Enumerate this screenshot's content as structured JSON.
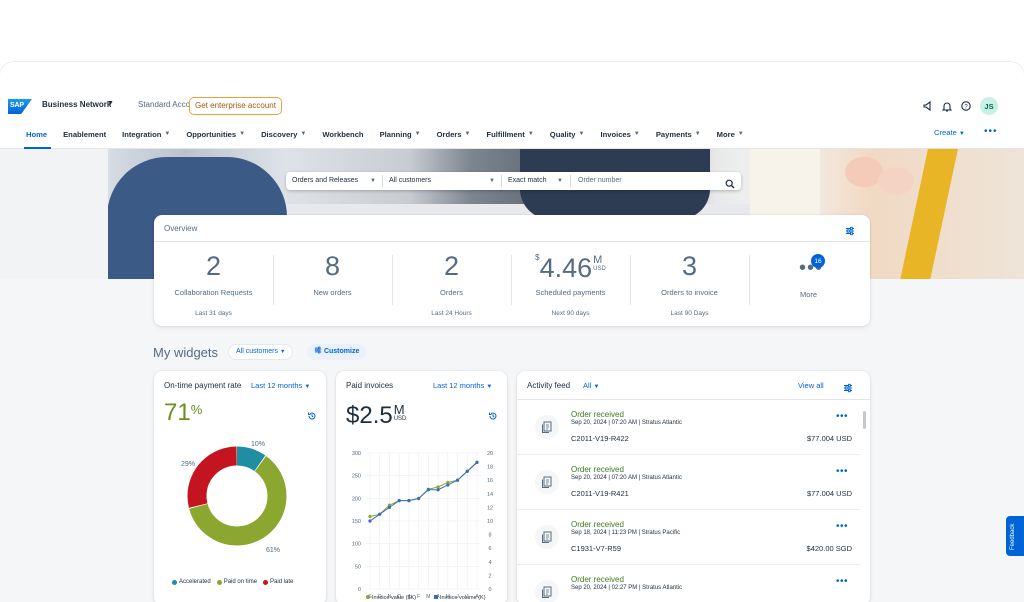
{
  "shell": {
    "logo": "SAP",
    "product": "Business Network",
    "account": "Standard Account",
    "enterprise_button": "Get enterprise account",
    "avatar_initials": "JS"
  },
  "nav": {
    "items": [
      {
        "label": "Home",
        "active": true,
        "dropdown": false
      },
      {
        "label": "Enablement",
        "dropdown": false
      },
      {
        "label": "Integration",
        "dropdown": true
      },
      {
        "label": "Opportunities",
        "dropdown": true
      },
      {
        "label": "Discovery",
        "dropdown": true
      },
      {
        "label": "Workbench",
        "dropdown": false
      },
      {
        "label": "Planning",
        "dropdown": true
      },
      {
        "label": "Orders",
        "dropdown": true
      },
      {
        "label": "Fulfillment",
        "dropdown": true
      },
      {
        "label": "Quality",
        "dropdown": true
      },
      {
        "label": "Invoices",
        "dropdown": true
      },
      {
        "label": "Payments",
        "dropdown": true
      },
      {
        "label": "More",
        "dropdown": true
      }
    ],
    "create": "Create"
  },
  "search": {
    "type": "Orders and Releases",
    "customers": "All customers",
    "match": "Exact match",
    "placeholder": "Order number"
  },
  "overview": {
    "title": "Overview",
    "kpis": [
      {
        "value": "2",
        "label": "Collaboration Requests",
        "sub": "Last 31 days"
      },
      {
        "value": "8",
        "label": "New orders",
        "sub": ""
      },
      {
        "value": "2",
        "label": "Orders",
        "sub": "Last 24 Hours"
      },
      {
        "currency": "$",
        "value": "4.46",
        "unit": "M",
        "unit_sub": "USD",
        "label": "Scheduled payments",
        "sub": "Next 90 days"
      },
      {
        "value": "3",
        "label": "Orders to invoice",
        "sub": "Last 90 Days"
      },
      {
        "label": "More",
        "badge": "16"
      }
    ]
  },
  "widgets": {
    "title": "My widgets",
    "customers": "All customers",
    "customize": "Customize"
  },
  "ontime": {
    "title": "On-time payment rate",
    "filter": "Last 12 months",
    "value": "71",
    "pct": "%",
    "slices": [
      {
        "name": "Accelerated",
        "pct": 10,
        "label": "10%",
        "color": "#1f8ea3"
      },
      {
        "name": "Paid on time",
        "pct": 61,
        "label": "61%",
        "color": "#8ba72f"
      },
      {
        "name": "Paid late",
        "pct": 29,
        "label": "29%",
        "color": "#c4141f"
      }
    ]
  },
  "paid": {
    "title": "Paid invoices",
    "filter": "Last 12 months",
    "value": "$2.5",
    "unit": "M",
    "unit_sub": "USD",
    "legend_value": "Invoice value ($K)",
    "legend_volume": "Invoice volume (K)"
  },
  "chart_data": {
    "type": "line",
    "categories": [
      "S",
      "O",
      "N",
      "D",
      "J",
      "F",
      "M",
      "A",
      "M",
      "J",
      "J",
      "A"
    ],
    "year_labels": [
      "2023",
      "2024"
    ],
    "ylim_left": [
      0,
      300
    ],
    "yticks_left": [
      0,
      50,
      100,
      150,
      200,
      250,
      300
    ],
    "ylim_right": [
      0,
      20
    ],
    "yticks_right": [
      0,
      2,
      4,
      6,
      8,
      10,
      12,
      14,
      16,
      18,
      20
    ],
    "grid": true,
    "legend_position": "bottom",
    "series": [
      {
        "name": "Invoice value ($K)",
        "axis": "left",
        "color": "#8ba72f",
        "values": [
          160,
          165,
          185,
          195,
          195,
          200,
          220,
          225,
          235,
          240,
          260,
          280
        ]
      },
      {
        "name": "Invoice volume (K)",
        "axis": "right",
        "color": "#3b6bbf",
        "values": [
          10,
          11,
          12,
          13,
          13,
          13.3,
          14.6,
          14.6,
          15.3,
          16,
          17.3,
          18.6
        ]
      }
    ]
  },
  "activity": {
    "title": "Activity feed",
    "filter": "All",
    "view_all": "View all",
    "items": [
      {
        "title": "Order received",
        "meta": "Sep 20, 2024  |  07:20 AM  |  Stratus Atlantic",
        "id": "C2011-V19-R422",
        "amount": "$77.004 USD"
      },
      {
        "title": "Order received",
        "meta": "Sep 20, 2024  |  07:20 AM  |  Stratus Atlantic",
        "id": "C2011-V19-R421",
        "amount": "$77.004 USD"
      },
      {
        "title": "Order received",
        "meta": "Sep 18, 2024  |  11:23 PM  |  Stratus Pacific",
        "id": "C1931-V7-R59",
        "amount": "$420.00 SGD"
      },
      {
        "title": "Order received",
        "meta": "Sep 20, 2024  |  02:27 PM  |  Stratus Atlantic",
        "id": "",
        "amount": ""
      }
    ]
  },
  "feedback": "Feedback",
  "colors": {
    "brand": "#0064d9",
    "accent_green": "#6a8f1d",
    "warning": "#e9a23b"
  }
}
